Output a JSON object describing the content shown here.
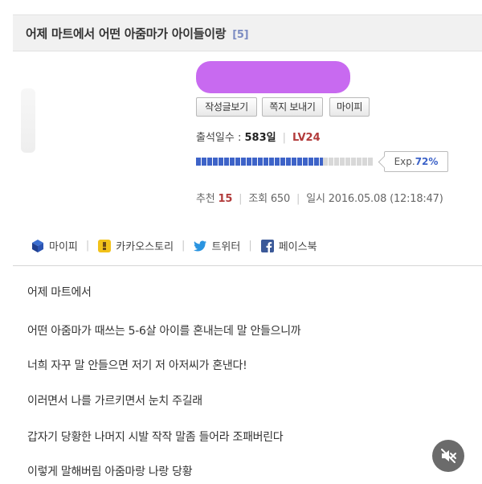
{
  "post": {
    "title": "어제 마트에서 어떤 아줌마가 아이들이랑",
    "comment_count": "[5]"
  },
  "profile": {
    "buttons": [
      "작성글보기",
      "쪽지 보내기",
      "마이피"
    ],
    "attendance_label": "출석일수 :",
    "attendance_value": "583일",
    "level": "LV24",
    "exp_label": "Exp.",
    "exp_percent": "72%",
    "exp_fraction": 0.72
  },
  "meta": {
    "recommend_label": "추천",
    "recommend_value": "15",
    "views_label": "조회",
    "views_value": "650",
    "date_label": "일시",
    "date_value": "2016.05.08 (12:18:47)"
  },
  "share": {
    "mypi": "마이피",
    "kakao": "카카오스토리",
    "twitter": "트위터",
    "facebook": "페이스북"
  },
  "body_lines": [
    "어제 마트에서",
    "어떤 아줌마가 때쓰는 5-6살 아이를 혼내는데 말 안들으니까",
    "너희 자꾸 말 안들으면 저기 저 아저씨가 혼낸다!",
    "이러면서 나를 가르키면서 눈치 주길래",
    "갑자기 당황한 나머지 시발 작작 말좀 들어라 조패버린다",
    "이렇게 말해버림 아줌마랑 나랑 당황"
  ],
  "colors": {
    "accent_blue": "#3d63c8",
    "level_red": "#b23b3b",
    "redaction": "#c86af0"
  },
  "icons": {
    "mute": "speaker-muted-icon"
  }
}
